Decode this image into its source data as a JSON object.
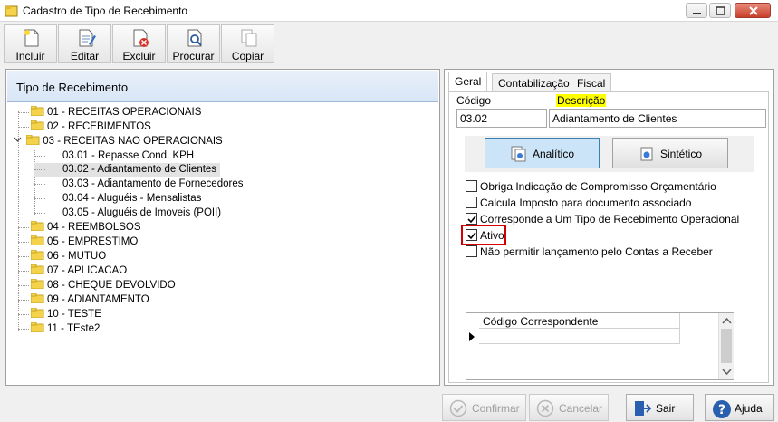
{
  "window": {
    "title": "Cadastro de Tipo de Recebimento"
  },
  "toolbar": {
    "buttons": [
      {
        "label": "Incluir",
        "icon": "new-document-icon"
      },
      {
        "label": "Editar",
        "icon": "edit-document-icon"
      },
      {
        "label": "Excluir",
        "icon": "delete-document-icon"
      },
      {
        "label": "Procurar",
        "icon": "search-document-icon"
      },
      {
        "label": "Copiar",
        "icon": "copy-document-icon"
      }
    ]
  },
  "tree": {
    "header": "Tipo de Recebimento",
    "items": [
      {
        "label": "01 - RECEITAS OPERACIONAIS"
      },
      {
        "label": "02 - RECEBIMENTOS"
      },
      {
        "label": "03 - RECEITAS NAO OPERACIONAIS"
      },
      {
        "label": "03.01 - Repasse Cond. KPH"
      },
      {
        "label": "03.02 - Adiantamento de Clientes"
      },
      {
        "label": "03.03 - Adiantamento de Fornecedores"
      },
      {
        "label": "03.04 - Aluguéis - Mensalistas"
      },
      {
        "label": "03.05 - Aluguéis de Imoveis (POII)"
      },
      {
        "label": "04 - REEMBOLSOS"
      },
      {
        "label": "05 - EMPRESTIMO"
      },
      {
        "label": "06 - MUTUO"
      },
      {
        "label": "07 - APLICACAO"
      },
      {
        "label": "08 - CHEQUE DEVOLVIDO"
      },
      {
        "label": "09 - ADIANTAMENTO"
      },
      {
        "label": "10 - TESTE"
      },
      {
        "label": "11 - TEste2"
      }
    ]
  },
  "tabs": [
    {
      "label": "Geral"
    },
    {
      "label": "Contabilização"
    },
    {
      "label": "Fiscal"
    }
  ],
  "form": {
    "codigo_label": "Código",
    "descricao_label": "Descrição",
    "codigo_value": "03.02",
    "descricao_value": "Adiantamento de Clientes",
    "type_buttons": [
      {
        "label": "Analítico",
        "active": true
      },
      {
        "label": "Sintético",
        "active": false
      }
    ],
    "checkboxes": [
      {
        "label": "Obriga Indicação de Compromisso Orçamentário",
        "checked": false
      },
      {
        "label": "Calcula Imposto para documento associado",
        "checked": false
      },
      {
        "label": "Corresponde a Um Tipo de Recebimento Operacional",
        "checked": true
      },
      {
        "label": "Ativo",
        "checked": true
      },
      {
        "label": "Não permitir lançamento pelo Contas a Receber",
        "checked": false
      }
    ],
    "grid_header": "Código Correspondente"
  },
  "footer": {
    "buttons": [
      {
        "label": "Confirmar",
        "enabled": false
      },
      {
        "label": "Cancelar",
        "enabled": false
      },
      {
        "label": "Sair",
        "enabled": true
      },
      {
        "label": "Ajuda",
        "enabled": true
      }
    ]
  },
  "colors": {
    "highlight": "#ffff00",
    "active_button": "#cce4f7",
    "annotation_box": "#d20000",
    "folder_yellow": "#f4d34a"
  }
}
